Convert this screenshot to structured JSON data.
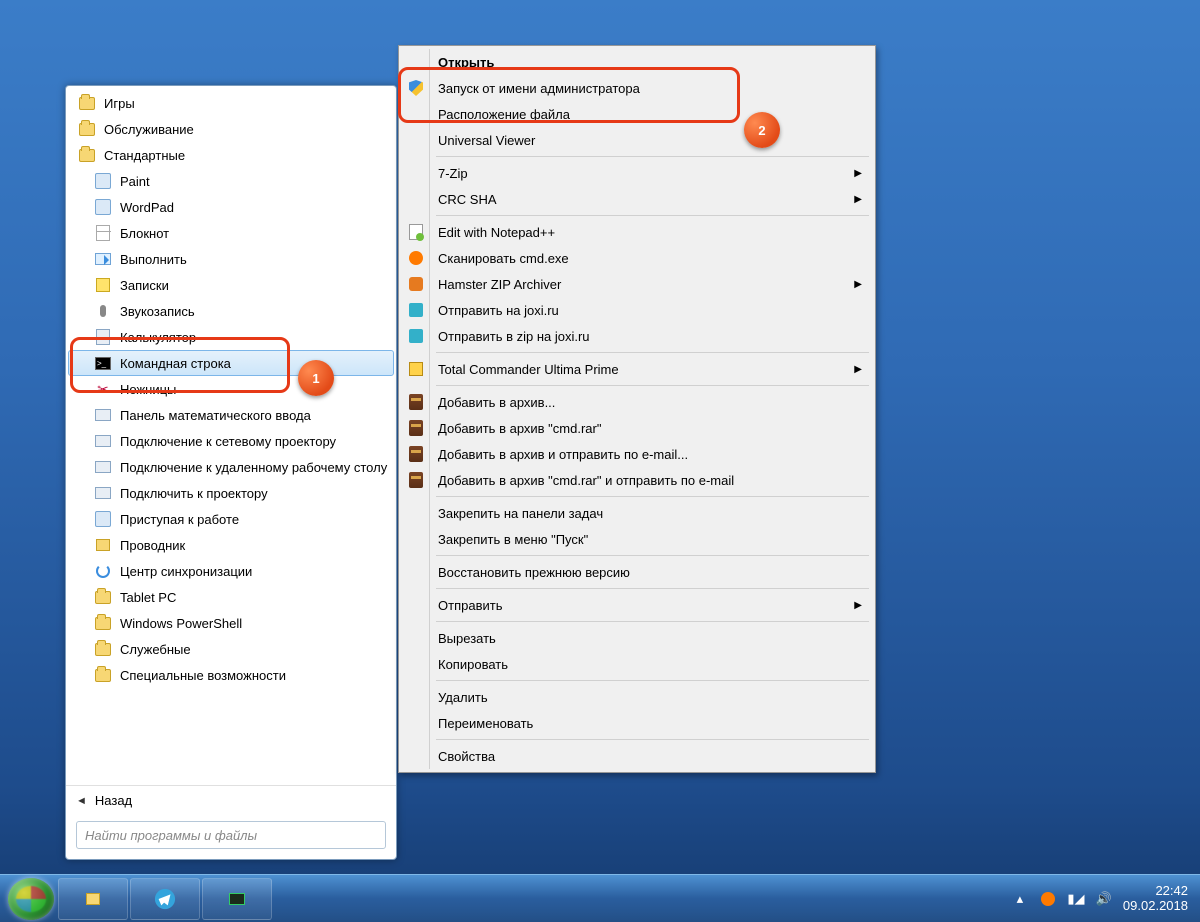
{
  "start_menu": {
    "items": [
      {
        "label": "Игры",
        "icon": "folder",
        "indent": false
      },
      {
        "label": "Обслуживание",
        "icon": "folder",
        "indent": false
      },
      {
        "label": "Стандартные",
        "icon": "folder",
        "indent": false
      },
      {
        "label": "Paint",
        "icon": "app",
        "indent": true
      },
      {
        "label": "WordPad",
        "icon": "app",
        "indent": true
      },
      {
        "label": "Блокнот",
        "icon": "note",
        "indent": true
      },
      {
        "label": "Выполнить",
        "icon": "run",
        "indent": true
      },
      {
        "label": "Записки",
        "icon": "stick",
        "indent": true
      },
      {
        "label": "Звукозапись",
        "icon": "mic",
        "indent": true
      },
      {
        "label": "Калькулятор",
        "icon": "calc",
        "indent": true
      },
      {
        "label": "Командная строка",
        "icon": "cmd",
        "indent": true,
        "hover": true
      },
      {
        "label": "Ножницы",
        "icon": "scis",
        "indent": true
      },
      {
        "label": "Панель математического ввода",
        "icon": "panel",
        "indent": true
      },
      {
        "label": "Подключение к сетевому проектору",
        "icon": "panel",
        "indent": true
      },
      {
        "label": "Подключение к удаленному рабочему столу",
        "icon": "panel",
        "indent": true
      },
      {
        "label": "Подключить к проектору",
        "icon": "panel",
        "indent": true
      },
      {
        "label": "Приступая к работе",
        "icon": "app",
        "indent": true
      },
      {
        "label": "Проводник",
        "icon": "explore",
        "indent": true
      },
      {
        "label": "Центр синхронизации",
        "icon": "sync",
        "indent": true
      },
      {
        "label": "Tablet PC",
        "icon": "folder",
        "indent": true
      },
      {
        "label": "Windows PowerShell",
        "icon": "folder",
        "indent": true
      },
      {
        "label": "Служебные",
        "icon": "folder",
        "indent": true
      },
      {
        "label": "Специальные возможности",
        "icon": "folder",
        "indent": true
      }
    ],
    "back": "Назад",
    "search_placeholder": "Найти программы и файлы"
  },
  "context_menu": {
    "rows": [
      {
        "label": "Открыть",
        "bold": true
      },
      {
        "label": "Запуск от имени администратора",
        "icon": "shield"
      },
      {
        "label": "Расположение файла"
      },
      {
        "label": "Universal Viewer"
      },
      {
        "sep": true
      },
      {
        "label": "7-Zip",
        "submenu": true
      },
      {
        "label": "CRC SHA",
        "submenu": true
      },
      {
        "sep": true
      },
      {
        "label": "Edit with Notepad++",
        "icon": "np"
      },
      {
        "label": "Сканировать cmd.exe",
        "icon": "av"
      },
      {
        "label": "Hamster ZIP Archiver",
        "icon": "ham",
        "submenu": true
      },
      {
        "label": "Отправить на joxi.ru",
        "icon": "j"
      },
      {
        "label": "Отправить в zip на joxi.ru",
        "icon": "j"
      },
      {
        "sep": true
      },
      {
        "label": "Total Commander Ultima Prime",
        "icon": "tc",
        "submenu": true
      },
      {
        "sep": true
      },
      {
        "label": "Добавить в архив...",
        "icon": "rar"
      },
      {
        "label": "Добавить в архив \"cmd.rar\"",
        "icon": "rar"
      },
      {
        "label": "Добавить в архив и отправить по e-mail...",
        "icon": "rar"
      },
      {
        "label": "Добавить в архив \"cmd.rar\" и отправить по e-mail",
        "icon": "rar"
      },
      {
        "sep": true
      },
      {
        "label": "Закрепить на панели задач"
      },
      {
        "label": "Закрепить в меню \"Пуск\""
      },
      {
        "sep": true
      },
      {
        "label": "Восстановить прежнюю версию"
      },
      {
        "sep": true
      },
      {
        "label": "Отправить",
        "submenu": true
      },
      {
        "sep": true
      },
      {
        "label": "Вырезать"
      },
      {
        "label": "Копировать"
      },
      {
        "sep": true
      },
      {
        "label": "Удалить"
      },
      {
        "label": "Переименовать"
      },
      {
        "sep": true
      },
      {
        "label": "Свойства"
      }
    ]
  },
  "annotations": {
    "badge1": "1",
    "badge2": "2"
  },
  "tray": {
    "time": "22:42",
    "date": "09.02.2018"
  }
}
